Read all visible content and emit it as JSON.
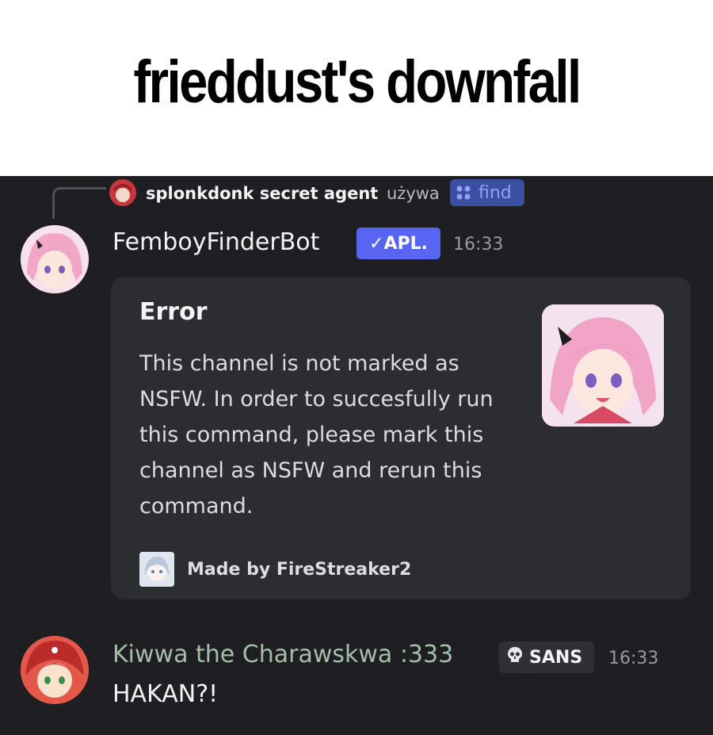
{
  "caption": "frieddust's downfall",
  "reply": {
    "author": "splonkdonk secret agent",
    "verb": "używa",
    "command": "find",
    "command_icon": "slash-command-icon"
  },
  "bot_message": {
    "author": "FemboyFinderBot",
    "badge": "✓APL.",
    "time": "16:33",
    "embed": {
      "title": "Error",
      "description": "This channel is not marked as NSFW. In order to succesfully run this command, please mark this channel as NSFW and rerun this command.",
      "footer": "Made by FireStreaker2"
    }
  },
  "user_message": {
    "author": "Kiwwa the Charawskwa :333",
    "tag": "SANS",
    "tag_icon": "skull-icon",
    "time": "16:33",
    "content": "HAKAN?!"
  },
  "colors": {
    "background": "#1f1f23",
    "embed": "#2b2d31",
    "app_badge": "#5865f2",
    "kiwwa_name": "#a4bfa8"
  }
}
